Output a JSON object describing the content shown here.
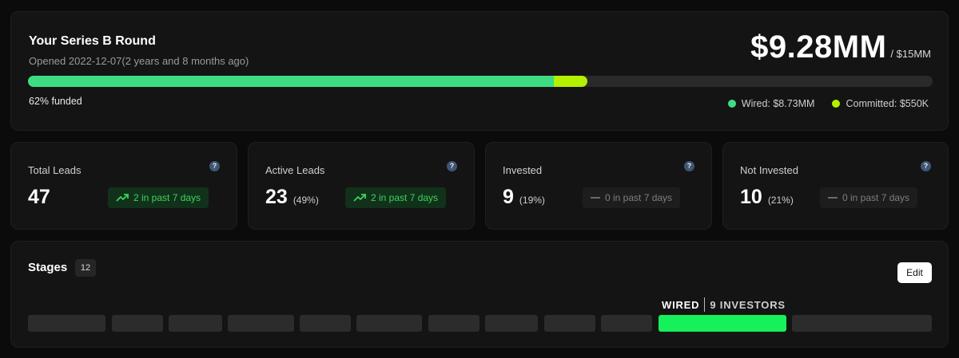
{
  "round": {
    "title": "Your Series B Round",
    "opened": "Opened 2022-12-07(2 years and 8 months ago)",
    "amount": "$9.28MM",
    "target": "/ $15MM",
    "funded_label": "62% funded",
    "wired_fraction": 0.581,
    "committed_fraction": 0.037,
    "legend": [
      {
        "label": "Wired: $8.73MM",
        "color": "#3ddc84"
      },
      {
        "label": "Committed: $550K",
        "color": "#b4f000"
      }
    ]
  },
  "stats": [
    {
      "label": "Total Leads",
      "value": "47",
      "pct": "",
      "trend": "2  in past 7 days",
      "trend_type": "up"
    },
    {
      "label": "Active Leads",
      "value": "23",
      "pct": "(49%)",
      "trend": "2  in past 7 days",
      "trend_type": "up"
    },
    {
      "label": "Invested",
      "value": "9",
      "pct": "(19%)",
      "trend": "0  in past 7 days",
      "trend_type": "flat"
    },
    {
      "label": "Not Invested",
      "value": "10",
      "pct": "(21%)",
      "trend": "0  in past 7 days",
      "trend_type": "flat"
    }
  ],
  "help_glyph": "?",
  "stages": {
    "title": "Stages",
    "count": "12",
    "edit_label": "Edit",
    "active_name": "WIRED",
    "active_investors": "9 INVESTORS",
    "active_color": "#16f05a",
    "active_index": 10
  }
}
